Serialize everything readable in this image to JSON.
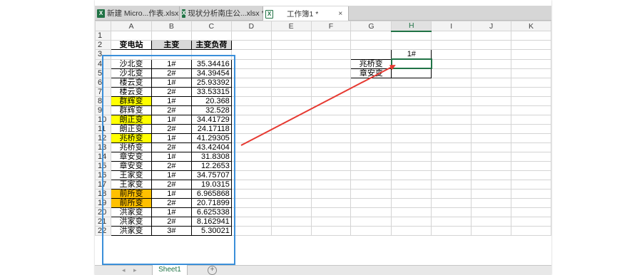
{
  "tabs": [
    {
      "icon": "X",
      "label": "新建 Micro...作表.xlsx"
    },
    {
      "icon": "X",
      "label": "现状分析南庄公...xlsx *"
    },
    {
      "icon": "X",
      "label": "工作簿1 *",
      "close": "×"
    }
  ],
  "columns": [
    "A",
    "B",
    "C",
    "D",
    "E",
    "F",
    "G",
    "H",
    "I",
    "J",
    "K"
  ],
  "selected_column": "H",
  "row_numbers": [
    "1",
    "2",
    "3",
    "4",
    "5",
    "6",
    "7",
    "8",
    "9",
    "10",
    "11",
    "12",
    "13",
    "14",
    "15",
    "16",
    "17",
    "18",
    "19",
    "20",
    "21",
    "22"
  ],
  "headers": {
    "a": "变电站",
    "b": "主变",
    "c": "主变负荷"
  },
  "rows": [
    {
      "a": "沙北变",
      "b": "1#",
      "c": "35.34416",
      "hl": ""
    },
    {
      "a": "沙北变",
      "b": "2#",
      "c": "34.39454",
      "hl": ""
    },
    {
      "a": "楼云变",
      "b": "1#",
      "c": "25.93392",
      "hl": ""
    },
    {
      "a": "楼云变",
      "b": "2#",
      "c": "33.53315",
      "hl": ""
    },
    {
      "a": "群辉变",
      "b": "1#",
      "c": "20.368",
      "hl": "yellow"
    },
    {
      "a": "群辉变",
      "b": "2#",
      "c": "32.528",
      "hl": ""
    },
    {
      "a": "朗正变",
      "b": "1#",
      "c": "34.41729",
      "hl": "yellow"
    },
    {
      "a": "朗正变",
      "b": "2#",
      "c": "24.17118",
      "hl": ""
    },
    {
      "a": "兆桥变",
      "b": "1#",
      "c": "41.29305",
      "hl": "yellow"
    },
    {
      "a": "兆桥变",
      "b": "2#",
      "c": "43.42404",
      "hl": ""
    },
    {
      "a": "章安变",
      "b": "1#",
      "c": "31.8308",
      "hl": ""
    },
    {
      "a": "章安变",
      "b": "2#",
      "c": "12.2653",
      "hl": ""
    },
    {
      "a": "王家变",
      "b": "1#",
      "c": "34.75707",
      "hl": ""
    },
    {
      "a": "王家变",
      "b": "2#",
      "c": "19.0315",
      "hl": ""
    },
    {
      "a": "前所变",
      "b": "1#",
      "c": "6.965868",
      "hl": "orange"
    },
    {
      "a": "前所变",
      "b": "2#",
      "c": "20.71899",
      "hl": "orange"
    },
    {
      "a": "洪家变",
      "b": "1#",
      "c": "6.625338",
      "hl": ""
    },
    {
      "a": "洪家变",
      "b": "2#",
      "c": "8.162941",
      "hl": ""
    },
    {
      "a": "洪家变",
      "b": "3#",
      "c": "5.30021",
      "hl": ""
    }
  ],
  "lookup": {
    "header": "1#",
    "row1": "兆桥变",
    "row2": "章安变"
  },
  "sheet_tab": "Sheet1",
  "add_sheet": "+",
  "colors": {
    "highlight_yellow": "#ffff00",
    "highlight_orange": "#ffc000",
    "excel_green": "#217346",
    "annotation_blue": "#3b8fd9",
    "arrow_red": "#e63a32"
  }
}
